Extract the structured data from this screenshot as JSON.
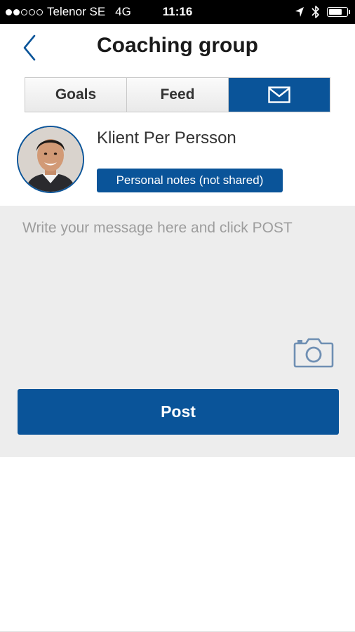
{
  "status_bar": {
    "signal_full": 2,
    "signal_empty": 3,
    "carrier": "Telenor SE",
    "network": "4G",
    "time": "11:16",
    "icons": [
      "location-arrow-icon",
      "bluetooth-icon",
      "battery-icon"
    ],
    "battery_level": 0.75
  },
  "header": {
    "title": "Coaching group",
    "back_icon": "chevron-left-icon"
  },
  "tabs": [
    {
      "label": "Goals",
      "active": false
    },
    {
      "label": "Feed",
      "active": false
    },
    {
      "label": "",
      "icon": "envelope-icon",
      "active": true
    }
  ],
  "profile": {
    "name": "Klient Per Persson",
    "badge": "Personal notes (not shared)"
  },
  "compose": {
    "placeholder": "Write your message here and click POST",
    "value": "",
    "camera_icon": "camera-icon",
    "post_label": "Post"
  },
  "colors": {
    "accent": "#0a5499",
    "compose_bg": "#ededed",
    "status_bar_bg": "#000000"
  }
}
